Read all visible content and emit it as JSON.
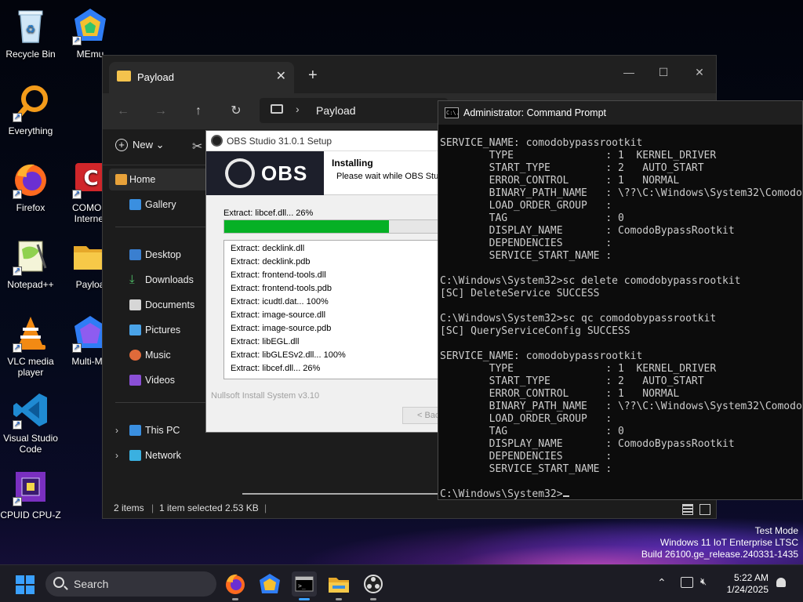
{
  "desktop": {
    "icons": [
      {
        "label": "Recycle Bin"
      },
      {
        "label": "MEmu"
      },
      {
        "label": "Everything"
      },
      {
        "label": "Firefox"
      },
      {
        "label": "COMOD",
        "label2": "Internet"
      },
      {
        "label": "Notepad++"
      },
      {
        "label": "Payloa"
      },
      {
        "label": "VLC media",
        "label2": "player"
      },
      {
        "label": "Multi-ME"
      },
      {
        "label": "Visual Studio",
        "label2": "Code"
      },
      {
        "label": "CPUID CPU-Z"
      }
    ]
  },
  "explorer": {
    "tab_title": "Payload",
    "close_tab": "✕",
    "new_tab": "+",
    "window_controls": {
      "minimize": "—",
      "maximize": "☐",
      "close": "✕"
    },
    "nav": {
      "back": "←",
      "forward": "→",
      "up": "↑",
      "refresh": "↻"
    },
    "breadcrumb": "Payload",
    "new_label": "New",
    "sidebar": {
      "home": "Home",
      "gallery": "Gallery",
      "desktop": "Desktop",
      "downloads": "Downloads",
      "documents": "Documents",
      "pictures": "Pictures",
      "music": "Music",
      "videos": "Videos",
      "this_pc": "This PC",
      "network": "Network"
    },
    "status": {
      "items": "2 items",
      "selected": "1 item selected  2.53 KB"
    }
  },
  "obs_installer": {
    "title": "OBS Studio 31.0.1 Setup",
    "logo_text": "OBS",
    "heading": "Installing",
    "subheading": "Please wait while OBS Studio",
    "progress_label": "Extract: libcef.dll... 26%",
    "progress_percent": 73,
    "log_lines": [
      "Extract: decklink.dll",
      "Extract: decklink.pdb",
      "Extract: frontend-tools.dll",
      "Extract: frontend-tools.pdb",
      "Extract: icudtl.dat... 100%",
      "Extract: image-source.dll",
      "Extract: image-source.pdb",
      "Extract: libEGL.dll",
      "Extract: libGLESv2.dll... 100%",
      "Extract: libcef.dll... 26%"
    ],
    "nsis_label": "Nullsoft Install System v3.10",
    "back_button": "< Bac"
  },
  "cmd": {
    "icon_text": "C:\\.",
    "title": "Administrator: Command Prompt",
    "lines": [
      "SERVICE_NAME: comodobypassrootkit",
      "        TYPE               : 1  KERNEL_DRIVER",
      "        START_TYPE         : 2   AUTO_START",
      "        ERROR_CONTROL      : 1   NORMAL",
      "        BINARY_PATH_NAME   : \\??\\C:\\Windows\\System32\\Comodo",
      "        LOAD_ORDER_GROUP   :",
      "        TAG                : 0",
      "        DISPLAY_NAME       : ComodoBypassRootkit",
      "        DEPENDENCIES       :",
      "        SERVICE_START_NAME :",
      "",
      "C:\\Windows\\System32>sc delete comodobypassrootkit",
      "[SC] DeleteService SUCCESS",
      "",
      "C:\\Windows\\System32>sc qc comodobypassrootkit",
      "[SC] QueryServiceConfig SUCCESS",
      "",
      "SERVICE_NAME: comodobypassrootkit",
      "        TYPE               : 1  KERNEL_DRIVER",
      "        START_TYPE         : 2   AUTO_START",
      "        ERROR_CONTROL      : 1   NORMAL",
      "        BINARY_PATH_NAME   : \\??\\C:\\Windows\\System32\\Comodo",
      "        LOAD_ORDER_GROUP   :",
      "        TAG                : 0",
      "        DISPLAY_NAME       : ComodoBypassRootkit",
      "        DEPENDENCIES       :",
      "        SERVICE_START_NAME :",
      ""
    ],
    "prompt": "C:\\Windows\\System32>"
  },
  "watermark": {
    "line1": "Test Mode",
    "line2": "Windows 11 IoT Enterprise LTSC",
    "line3": "Build 26100.ge_release.240331-1435"
  },
  "taskbar": {
    "search_label": "Search",
    "time": "5:22 AM",
    "date": "1/24/2025"
  },
  "colors": {
    "progress_fill": "#06b025",
    "accent": "#3aa0ff",
    "folder": "#f4c34d"
  }
}
